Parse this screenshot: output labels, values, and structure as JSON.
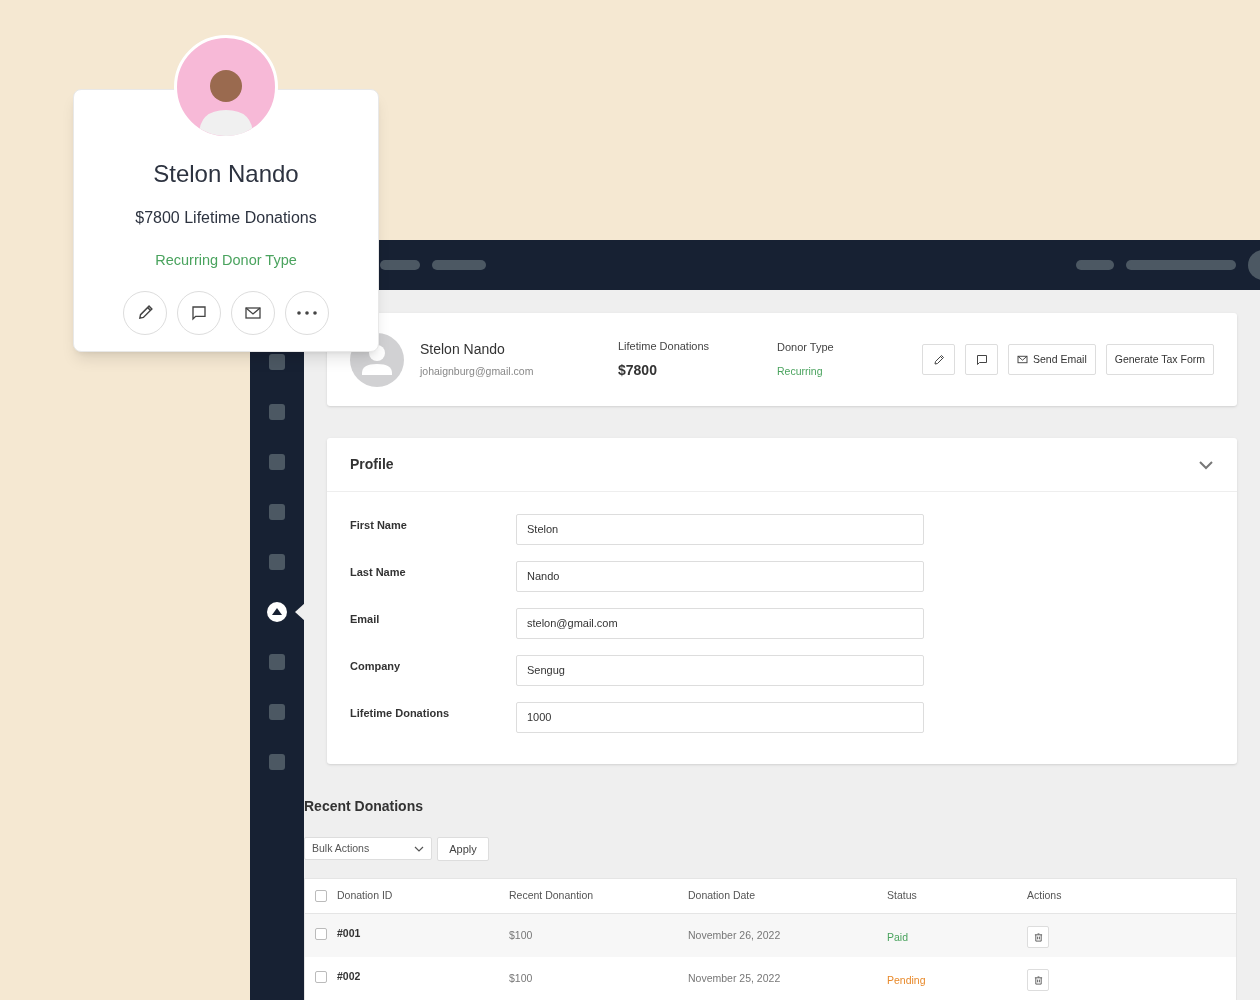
{
  "donor_card": {
    "name": "Stelon Nando",
    "lifetime": "$7800 Lifetime Donations",
    "donor_type": "Recurring Donor Type"
  },
  "sidebar": {
    "items": [
      {
        "selected": false
      },
      {
        "selected": false
      },
      {
        "selected": false
      },
      {
        "selected": false
      },
      {
        "selected": false
      },
      {
        "selected": true
      },
      {
        "selected": false
      },
      {
        "selected": false
      },
      {
        "selected": false
      }
    ]
  },
  "header": {
    "name": "Stelon Nando",
    "email": "johaignburg@gmail.com",
    "lifetime_label": "Lifetime Donations",
    "lifetime_value": "$7800",
    "type_label": "Donor Type",
    "type_value": "Recurring",
    "buttons": [
      "Send Email",
      "Generate Tax Form"
    ]
  },
  "profile": {
    "title": "Profile",
    "expanded": true,
    "fields": [
      {
        "label": "First Name",
        "value": "Stelon"
      },
      {
        "label": "Last Name",
        "value": "Nando"
      },
      {
        "label": "Email",
        "value": "stelon@gmail.com"
      },
      {
        "label": "Company",
        "value": "Sengug"
      },
      {
        "label": "Lifetime Donations",
        "value": "1000"
      }
    ]
  },
  "recent_donations": {
    "title": "Recent Donations",
    "bulk_select": "Bulk Actions",
    "apply": "Apply",
    "columns": [
      "Donation ID",
      "Recent Donantion",
      "Donation Date",
      "Status",
      "Actions"
    ],
    "all_checked": false,
    "rows": [
      {
        "id": "#001",
        "amount": "$100",
        "date": "November 26, 2022",
        "status": "Paid",
        "kind": "paid",
        "checked": false
      },
      {
        "id": "#002",
        "amount": "$100",
        "date": "November 25, 2022",
        "status": "Pending",
        "kind": "pending",
        "checked": false
      }
    ]
  }
}
